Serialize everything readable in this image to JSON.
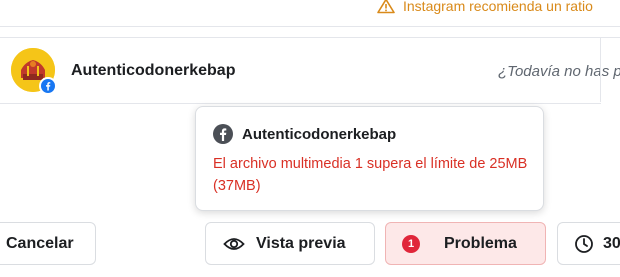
{
  "warning": {
    "text": "Instagram recomienda un ratio",
    "icon": "warning-triangle-icon",
    "color": "#d98a1a"
  },
  "account": {
    "name": "Autenticodonerkebap",
    "avatar_badge_icon": "facebook-icon",
    "status_text": "¿Todavía no has p"
  },
  "tooltip": {
    "platform_icon": "facebook-icon",
    "account_name": "Autenticodonerkebap",
    "error_text": "El archivo multimedia 1 supera el límite de 25MB (37MB)",
    "error_color": "#d93025"
  },
  "actions": {
    "cancel_label": "Cancelar",
    "preview_label": "Vista previa",
    "problem_count": "1",
    "problem_label": "Problema",
    "schedule_label": "30"
  }
}
